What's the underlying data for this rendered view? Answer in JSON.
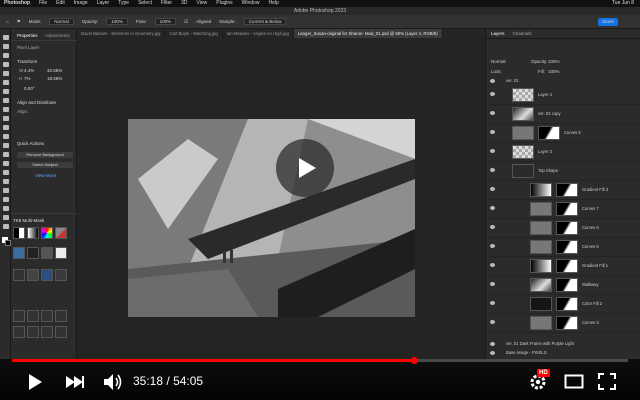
{
  "menubar": {
    "app": "Photoshop",
    "items": [
      "File",
      "Edit",
      "Image",
      "Layer",
      "Type",
      "Select",
      "Filter",
      "3D",
      "View",
      "Plugins",
      "Window",
      "Help"
    ],
    "clock": "Tue Jun 8"
  },
  "window_title": "Adobe Photoshop 2023",
  "options": {
    "mode_label": "Mode:",
    "mode_value": "Normal",
    "opacity_label": "Opacity:",
    "opacity_value": "100%",
    "flow_label": "Flow:",
    "flow_value": "100%",
    "aligned_label": "Aligned",
    "sample_label": "Sample:",
    "sample_value": "Current & Below",
    "share_label": "Share"
  },
  "doc_tabs": [
    "David Balsam - Elements in Geometry.jpg",
    "Carl Boyle - Watching.jpg",
    "Ian Meades - Angles en High.jpg",
    "Langer_Susan-original for Sharon- Mod_01.psd @ 50% (Layer 4, RGB/8)"
  ],
  "left_panel": {
    "tabs": [
      "Properties",
      "Adjustments"
    ],
    "pixel_layer_label": "Pixel Layer",
    "transform_label": "Transform",
    "w_label": "W",
    "w_value": "4.4%",
    "w_pct": "32.65%",
    "h_label": "H",
    "h_value": "7%",
    "h_pct": "18.56%",
    "angle_value": "0.00°",
    "align_label": "Align and Distribute",
    "align_sub": "Align:",
    "quick_actions_label": "Quick Actions",
    "remove_bg_label": "Remove Background",
    "select_subject_label": "Select Subject",
    "view_more_label": "View More",
    "plugin_title": "TK8 Multi-Mask"
  },
  "layers_panel": {
    "tabs": [
      "Layers",
      "Channels"
    ],
    "blend_mode": "Normal",
    "opacity_label": "Opacity:",
    "opacity_value": "100%",
    "fill_label": "Fill:",
    "fill_value": "100%",
    "lock_label": "Lock:",
    "top_group": "ver. 02",
    "layers": [
      {
        "name": "Layer 4",
        "thumb": "checker",
        "mask": false
      },
      {
        "name": "ver. 02 copy",
        "thumb": "photo",
        "mask": false
      },
      {
        "name": "Curves 8",
        "thumb": "curves",
        "mask": true
      },
      {
        "name": "Layer 3",
        "thumb": "checker",
        "mask": false
      },
      {
        "name": "Top Shape",
        "thumb": "folder",
        "mask": false
      },
      {
        "name": "Gradient Fill 3",
        "thumb": "gradient",
        "mask": true
      },
      {
        "name": "Curves 7",
        "thumb": "curves",
        "mask": true
      },
      {
        "name": "Curves 6",
        "thumb": "curves",
        "mask": true
      },
      {
        "name": "Curves 5",
        "thumb": "curves",
        "mask": true
      },
      {
        "name": "Gradient Fill 1",
        "thumb": "gradient",
        "mask": true
      },
      {
        "name": "Walkway",
        "thumb": "photo",
        "mask": true
      },
      {
        "name": "Color Fill 2",
        "thumb": "dark",
        "mask": true
      },
      {
        "name": "Curves 3",
        "thumb": "curves",
        "mask": true
      }
    ],
    "bottom_groups": [
      "ver. 01 Dark Frame with Purple Light",
      "Base image - PIXELS"
    ]
  },
  "video": {
    "time_current": "35:18",
    "time_separator": "/",
    "time_total": "54:05",
    "progress": 0.653,
    "hd_badge": "HD"
  },
  "colors": {
    "accent": "#1473e6",
    "progress": "#ff0000"
  }
}
